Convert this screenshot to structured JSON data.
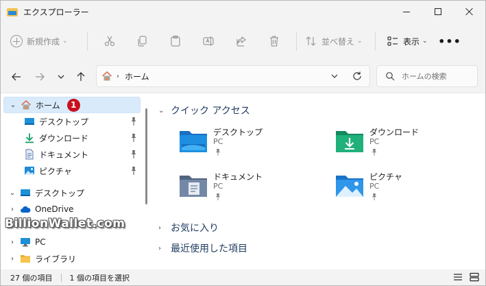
{
  "window": {
    "title": "エクスプローラー"
  },
  "commandbar": {
    "new_label": "新規作成",
    "sort_label": "並べ替え",
    "view_label": "表示",
    "more_label": "•••"
  },
  "address": {
    "crumb": "ホーム",
    "search_placeholder": "ホームの検索"
  },
  "sidebar": {
    "items": [
      {
        "label": "ホーム"
      },
      {
        "label": "デスクトップ"
      },
      {
        "label": "ダウンロード"
      },
      {
        "label": "ドキュメント"
      },
      {
        "label": "ピクチャ"
      },
      {
        "label": "デスクトップ"
      },
      {
        "label": "OneDrive"
      },
      {
        "label": "PC"
      },
      {
        "label": "ライブラリ"
      }
    ],
    "badge": "1",
    "watermark": "BillionWallet.com"
  },
  "main": {
    "quick_access": "クイック アクセス",
    "favorites": "お気に入り",
    "recent": "最近使用した項目",
    "items": [
      {
        "name": "デスクトップ",
        "location": "PC"
      },
      {
        "name": "ダウンロード",
        "location": "PC"
      },
      {
        "name": "ドキュメント",
        "location": "PC"
      },
      {
        "name": "ピクチャ",
        "location": "PC"
      }
    ]
  },
  "status": {
    "count": "27 個の項目",
    "selected": "1 個の項目を選択"
  },
  "colors": {
    "accent": "#0067c0",
    "selection": "#d9ebfb",
    "badge": "#c8101e"
  }
}
